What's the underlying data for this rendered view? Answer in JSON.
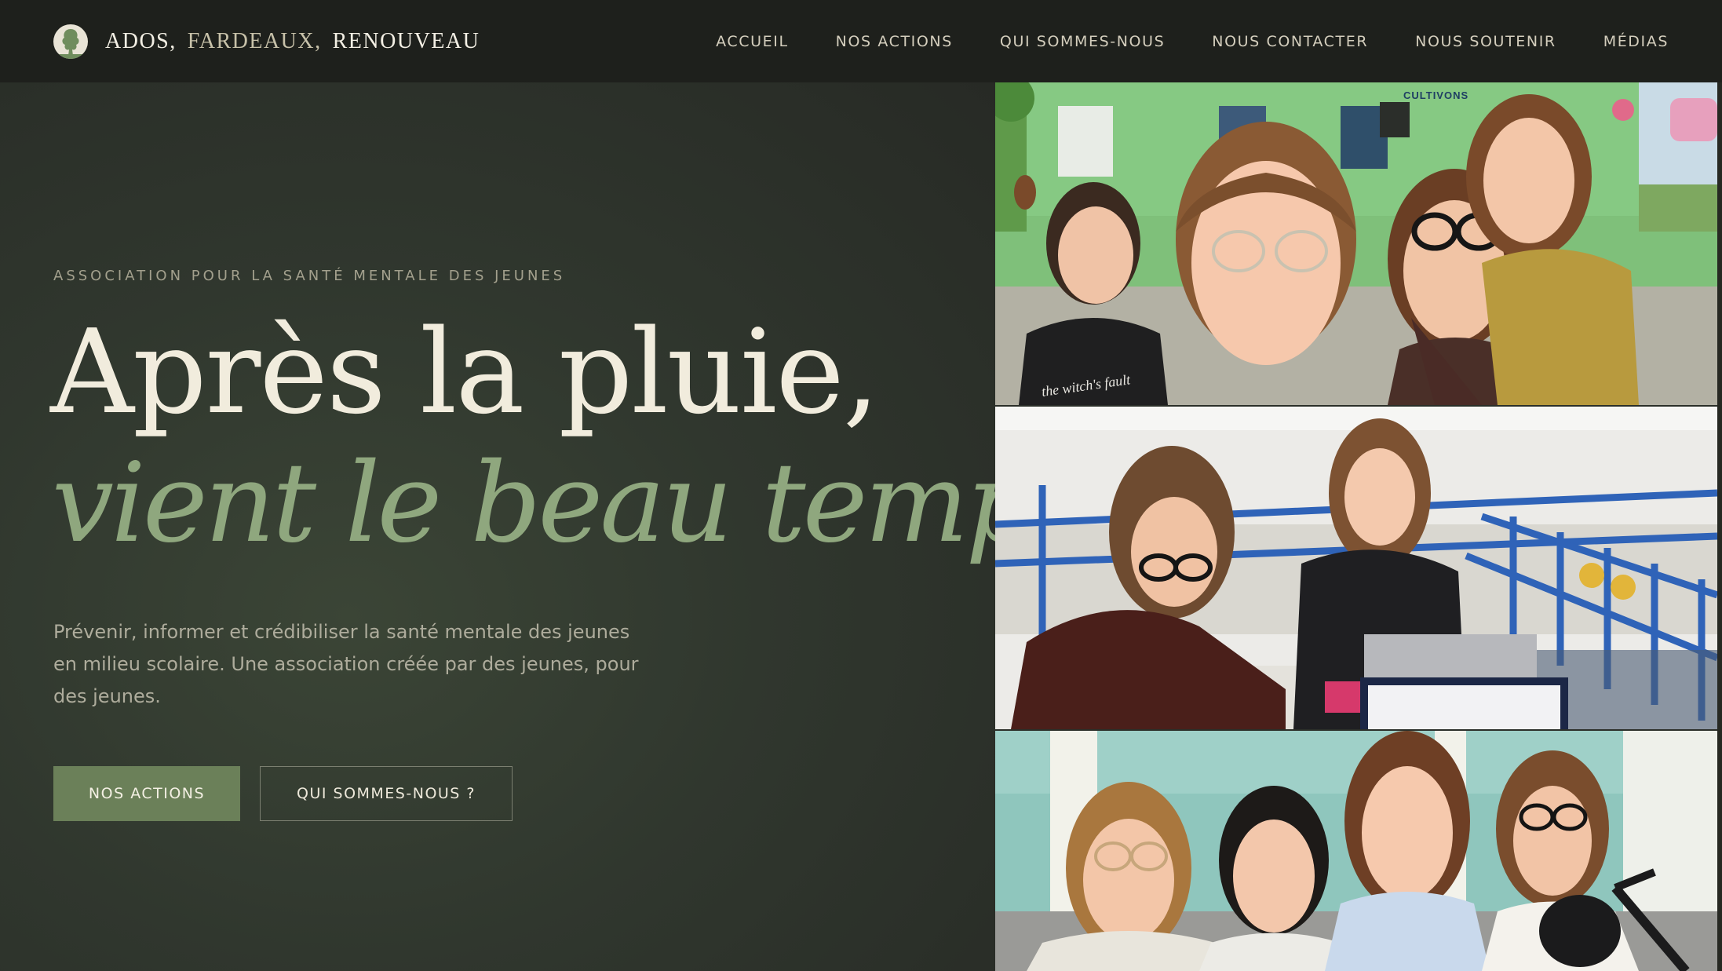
{
  "brand": {
    "word1": "ADOS,",
    "word2": "FARDEAUX,",
    "word3": "RENOUVEAU",
    "logo_icon": "tree-silhouette-logo"
  },
  "nav": {
    "items": [
      {
        "label": "ACCUEIL"
      },
      {
        "label": "NOS ACTIONS"
      },
      {
        "label": "QUI SOMMES-NOUS"
      },
      {
        "label": "NOUS CONTACTER"
      },
      {
        "label": "NOUS SOUTENIR"
      },
      {
        "label": "MÉDIAS"
      }
    ]
  },
  "hero": {
    "eyebrow": "ASSOCIATION POUR LA SANTÉ MENTALE DES JEUNES",
    "headline_line1": "Après la pluie,",
    "headline_line2": "vient le beau temps.",
    "lead": "Prévenir, informer et crédibiliser la santé mentale des jeunes en milieu scolaire. Une association créée par des jeunes, pour des jeunes.",
    "primary_button": "NOS ACTIONS",
    "secondary_button": "QUI SOMMES-NOUS ?"
  },
  "photos": {
    "photo1_caption": "CULTIVONS",
    "photo1_shirt_text": "the witch's fault"
  },
  "colors": {
    "nav_bg": "#1e201c",
    "hero_bg": "#2b2f29",
    "accent_green": "#8fa77e",
    "button_green": "#6b8059",
    "cream": "#f1ecdd"
  }
}
